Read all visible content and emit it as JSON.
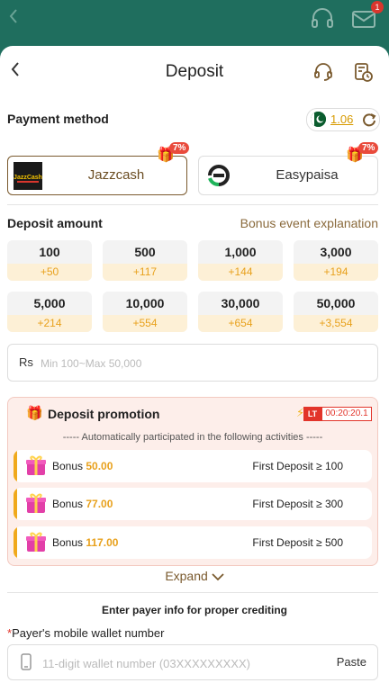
{
  "topbar": {
    "mail_badge": "1"
  },
  "header": {
    "title": "Deposit"
  },
  "payment": {
    "label": "Payment method",
    "balance": "1.06",
    "methods": [
      {
        "name": "Jazzcash",
        "logo_text": "JazzCash",
        "promo": "7%",
        "selected": true
      },
      {
        "name": "Easypaisa",
        "promo": "7%",
        "selected": false
      }
    ]
  },
  "deposit": {
    "label": "Deposit amount",
    "bonus_link": "Bonus event explanation",
    "amounts": [
      {
        "value": "100",
        "bonus": "+50"
      },
      {
        "value": "500",
        "bonus": "+117"
      },
      {
        "value": "1,000",
        "bonus": "+144"
      },
      {
        "value": "3,000",
        "bonus": "+194"
      },
      {
        "value": "5,000",
        "bonus": "+214"
      },
      {
        "value": "10,000",
        "bonus": "+554"
      },
      {
        "value": "30,000",
        "bonus": "+654"
      },
      {
        "value": "50,000",
        "bonus": "+3,554"
      }
    ],
    "currency": "Rs",
    "placeholder": "Min 100~Max 50,000"
  },
  "promotion": {
    "title": "Deposit promotion",
    "lt_label": "LT",
    "timer": "00:20:20.1",
    "subtitle": "----- Automatically participated in the following activities -----",
    "rows": [
      {
        "label": "Bonus",
        "amount": "50.00",
        "condition": "First Deposit ≥ 100"
      },
      {
        "label": "Bonus",
        "amount": "77.00",
        "condition": "First Deposit ≥ 300"
      },
      {
        "label": "Bonus",
        "amount": "117.00",
        "condition": "First Deposit ≥ 500"
      }
    ],
    "expand": "Expand"
  },
  "payer": {
    "hint": "Enter payer info for proper crediting",
    "required_mark": "*",
    "field_label": "Payer's mobile wallet number",
    "placeholder": "11-digit wallet number (03XXXXXXXXX)",
    "paste": "Paste"
  },
  "colors": {
    "topbar": "#1f6e5e",
    "accent_gold": "#e8a11d",
    "brown": "#7a5a2e",
    "promo_red": "#e2342a"
  },
  "icons": [
    "back-icon",
    "headset-icon",
    "mail-icon",
    "support-icon",
    "deposit-history-icon",
    "pakistan-flag-icon",
    "refresh-icon",
    "gift-icon",
    "bolt-icon",
    "chevron-down-icon",
    "phone-icon"
  ]
}
